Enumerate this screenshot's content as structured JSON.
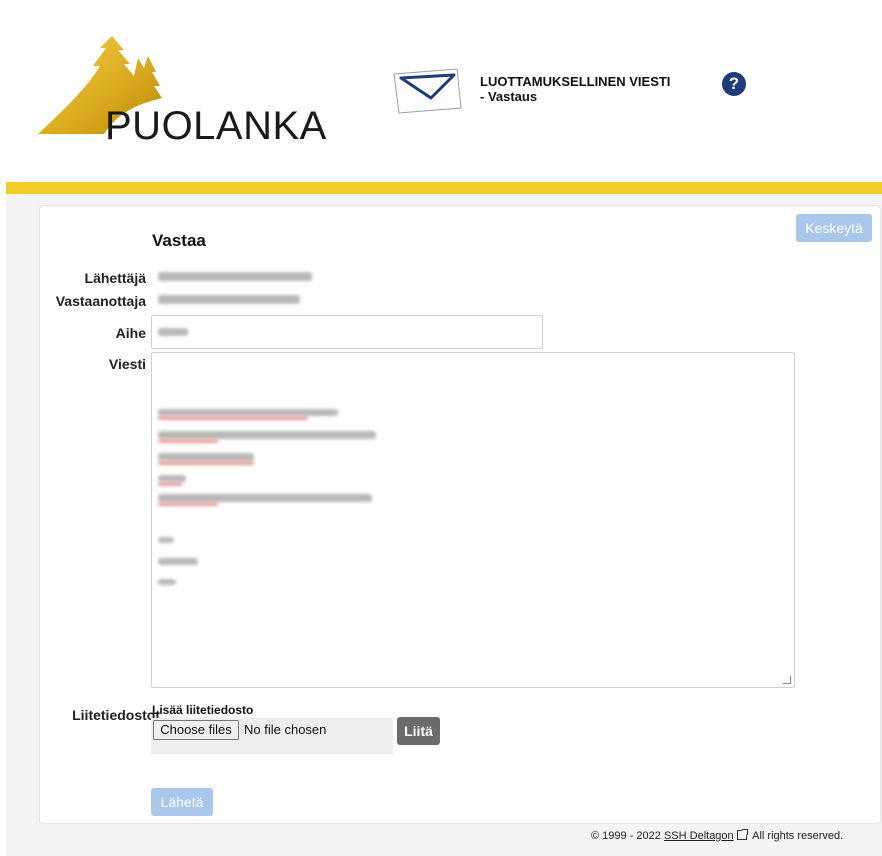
{
  "header": {
    "logo_text": "PUOLANKA",
    "title_line1": "LUOTTAMUKSELLINEN VIESTI",
    "title_line2": "- Vastaus",
    "help_symbol": "?"
  },
  "colors": {
    "accent_bar": "#f2cd27",
    "logo_gold": "#d9a81c",
    "help_blue": "#1f3c7a",
    "button_light_blue": "#a9c7eb",
    "attach_button": "#6b6b6b"
  },
  "form": {
    "cancel_label": "Keskeytä",
    "heading": "Vastaa",
    "sender_label": "Lähettäjä",
    "recipient_label": "Vastaanottaja",
    "subject_label": "Aihe",
    "message_label": "Viesti",
    "attachments_label": "Liitetiedostot",
    "add_attachment_label": "Lisää liitetiedosto",
    "choose_files_label": "Choose files",
    "no_file_text": "No file chosen",
    "attach_button_label": "Liitä",
    "send_label": "Lähetä"
  },
  "footer": {
    "copyright": "© 1999 - 2022",
    "link_text": "SSH Deltagon",
    "rights": "All rights reserved."
  }
}
